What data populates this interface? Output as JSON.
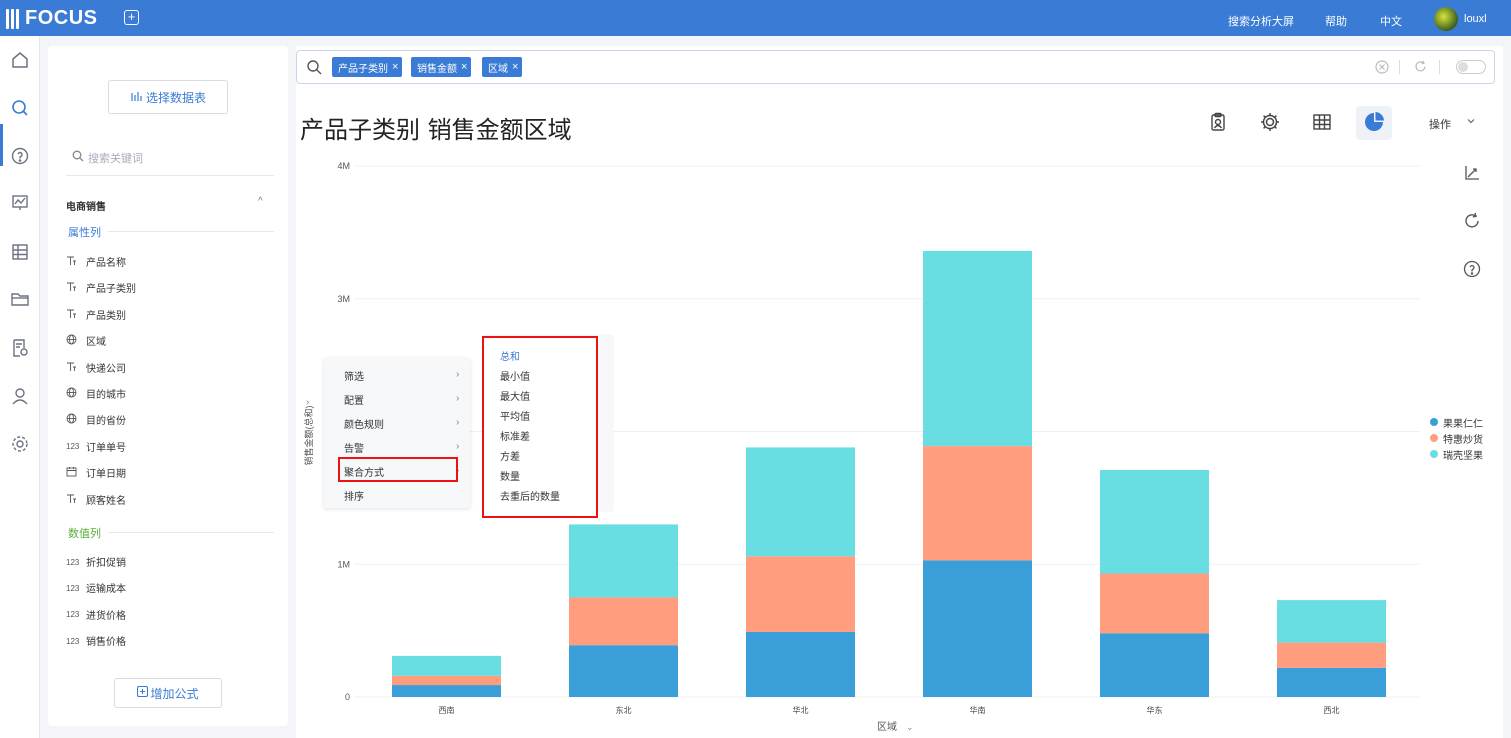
{
  "topbar": {
    "logo_text": "FOCUS",
    "links": [
      "搜索分析大屏",
      "帮助",
      "中文"
    ],
    "username": "louxl"
  },
  "rail_icons": [
    "home-icon",
    "search-icon",
    "help-icon",
    "dashboard-icon",
    "table-icon",
    "folder-icon",
    "settings-doc-icon",
    "user-icon",
    "gear-icon"
  ],
  "sidebar": {
    "select_table_label": "选择数据表",
    "search_placeholder": "搜索关键词",
    "group_title": "电商销售",
    "attr_section": "属性列",
    "attr_fields": [
      {
        "icon": "text",
        "label": "产品名称"
      },
      {
        "icon": "text",
        "label": "产品子类别"
      },
      {
        "icon": "text",
        "label": "产品类别"
      },
      {
        "icon": "globe",
        "label": "区域"
      },
      {
        "icon": "text",
        "label": "快递公司"
      },
      {
        "icon": "globe",
        "label": "目的城市"
      },
      {
        "icon": "globe",
        "label": "目的省份"
      },
      {
        "icon": "123",
        "label": "订单单号"
      },
      {
        "icon": "calendar",
        "label": "订单日期"
      },
      {
        "icon": "text",
        "label": "顾客姓名"
      }
    ],
    "value_section": "数值列",
    "value_fields": [
      {
        "icon": "123",
        "label": "折扣促销"
      },
      {
        "icon": "123",
        "label": "运输成本"
      },
      {
        "icon": "123",
        "label": "进货价格"
      },
      {
        "icon": "123",
        "label": "销售价格"
      }
    ],
    "add_formula_label": "增加公式"
  },
  "search": {
    "tokens": [
      "产品子类别",
      "销售金额",
      "区域"
    ]
  },
  "main": {
    "title": "产品子类别 销售金额区域",
    "ops_label": "操作"
  },
  "colors": {
    "accent": "#3a7bd5",
    "series": [
      "#3a9fd8",
      "#ff9d7e",
      "#68dde2"
    ]
  },
  "chart_data": {
    "type": "bar",
    "stacked": true,
    "categories": [
      "西南",
      "东北",
      "华北",
      "华南",
      "华东",
      "西北"
    ],
    "series": [
      {
        "name": "果果仁仁",
        "values": [
          90000,
          390000,
          490000,
          1030000,
          480000,
          220000
        ]
      },
      {
        "name": "特惠炒货",
        "values": [
          70000,
          360000,
          570000,
          860000,
          450000,
          190000
        ]
      },
      {
        "name": "瑞壳坚果",
        "values": [
          150000,
          550000,
          820000,
          1470000,
          780000,
          320000
        ]
      }
    ],
    "ylabel": "销售金额(总和)",
    "xlabel": "区域",
    "yticks": [
      "0",
      "1M",
      "",
      "3M",
      "4M"
    ],
    "ylim": [
      0,
      4000000
    ],
    "legend_position": "right"
  },
  "context_menu": {
    "items": [
      "筛选",
      "配置",
      "颜色规则",
      "告警",
      "聚合方式",
      "排序"
    ],
    "submenu": [
      "总和",
      "最小值",
      "最大值",
      "平均值",
      "标准差",
      "方差",
      "数量",
      "去重后的数量"
    ]
  }
}
